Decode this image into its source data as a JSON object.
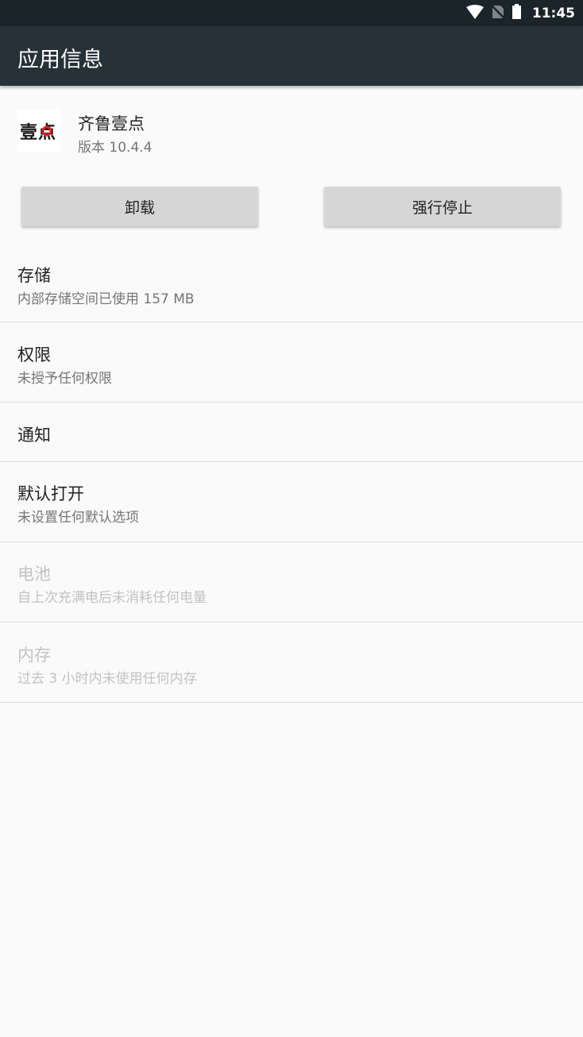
{
  "status_bar": {
    "time": "11:45",
    "icons": [
      "wifi-icon",
      "no-sim-icon",
      "battery-icon"
    ]
  },
  "app_bar": {
    "title": "应用信息"
  },
  "app": {
    "name": "齐鲁壹点",
    "version": "版本 10.4.4",
    "icon_text": "壹点",
    "icon_colors": {
      "text": "#1a1a1a",
      "accent": "#e0201b"
    }
  },
  "buttons": {
    "uninstall": "卸载",
    "force_stop": "强行停止"
  },
  "settings": [
    {
      "key": "storage",
      "title": "存储",
      "summary": "内部存储空间已使用 157 MB",
      "enabled": true
    },
    {
      "key": "permissions",
      "title": "权限",
      "summary": "未授予任何权限",
      "enabled": true
    },
    {
      "key": "notifications",
      "title": "通知",
      "summary": "",
      "enabled": true
    },
    {
      "key": "open-by-default",
      "title": "默认打开",
      "summary": "未设置任何默认选项",
      "enabled": true
    },
    {
      "key": "battery",
      "title": "电池",
      "summary": "自上次充满电后未消耗任何电量",
      "enabled": false
    },
    {
      "key": "memory",
      "title": "内存",
      "summary": "过去 3 小时内未使用任何内存",
      "enabled": false
    }
  ],
  "colors": {
    "status_bar": "#1b2428",
    "app_bar": "#263238",
    "background": "#fafafa",
    "button": "#d6d6d6",
    "disabled_text": "#c2c2c2"
  }
}
